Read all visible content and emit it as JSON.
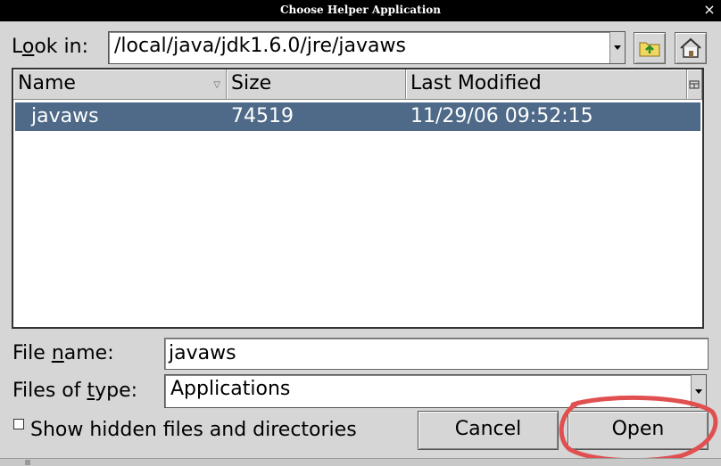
{
  "window": {
    "title": "Choose Helper Application",
    "close_label": "×"
  },
  "lookin": {
    "label_prefix": "L",
    "label_underlined": "o",
    "label_suffix": "ok in:",
    "path": "/local/java/jdk1.6.0/jre/javaws"
  },
  "toolbar": {
    "up_icon": "folder-up-icon",
    "home_icon": "home-icon"
  },
  "file_list": {
    "columns": [
      "Name",
      "Size",
      "Last Modified"
    ],
    "rows": [
      {
        "name": "javaws",
        "size": "74519",
        "modified": "11/29/06 09:52:15",
        "selected": true
      }
    ]
  },
  "filename": {
    "label_prefix": "File ",
    "label_underlined": "n",
    "label_suffix": "ame:",
    "value": "javaws"
  },
  "filetype": {
    "label_prefix": "Files of ",
    "label_underlined": "t",
    "label_suffix": "ype:",
    "value": "Applications"
  },
  "hidden_files": {
    "label": "Show hidden files and directories",
    "checked": false
  },
  "buttons": {
    "cancel": "Cancel",
    "open": "Open"
  },
  "colors": {
    "selection": "#4e6a88",
    "annotation": "#e05050",
    "background": "#d6d6d6"
  }
}
